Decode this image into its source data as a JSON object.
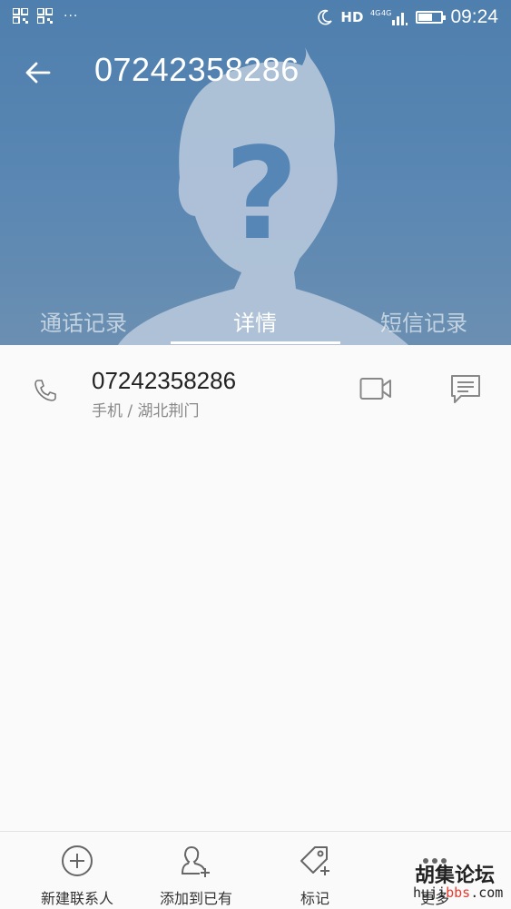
{
  "status_bar": {
    "time": "09:24",
    "hd": "HD",
    "network": "4G 4G",
    "dots": "···"
  },
  "header": {
    "title": "07242358286"
  },
  "tabs": [
    {
      "label": "通话记录",
      "active": false
    },
    {
      "label": "详情",
      "active": true
    },
    {
      "label": "短信记录",
      "active": false
    }
  ],
  "detail": {
    "number": "07242358286",
    "subline": "手机 / 湖北荆门"
  },
  "bottom_bar": [
    {
      "label": "新建联系人",
      "icon": "add-circle-icon"
    },
    {
      "label": "添加到已有",
      "icon": "add-person-icon"
    },
    {
      "label": "标记",
      "icon": "tag-icon"
    },
    {
      "label": "更多",
      "icon": "more-icon"
    }
  ],
  "watermark": {
    "title": "胡集论坛",
    "url_prefix": "huji",
    "url_red": "bbs",
    "url_suffix": ".com"
  },
  "colors": {
    "header": "#5481ad",
    "accent": "#2c6fb7"
  }
}
